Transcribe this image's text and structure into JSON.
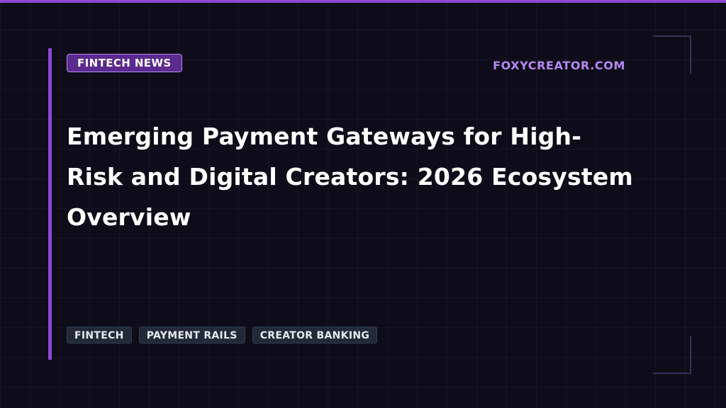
{
  "header": {
    "category": "FINTECH NEWS",
    "site": "FOXYCREATOR.COM"
  },
  "article": {
    "title": "Emerging Payment Gateways for High-Risk and Digital Creators: 2026 Ecosystem Overview"
  },
  "tags": [
    "FINTECH",
    "PAYMENT RAILS",
    "CREATOR BANKING"
  ],
  "colors": {
    "accent": "#8b47d6",
    "accent_light": "#b48af0",
    "badge_background": "#5b2a8f",
    "background": "#0f0c1a",
    "tag_background": "#222a3a"
  }
}
